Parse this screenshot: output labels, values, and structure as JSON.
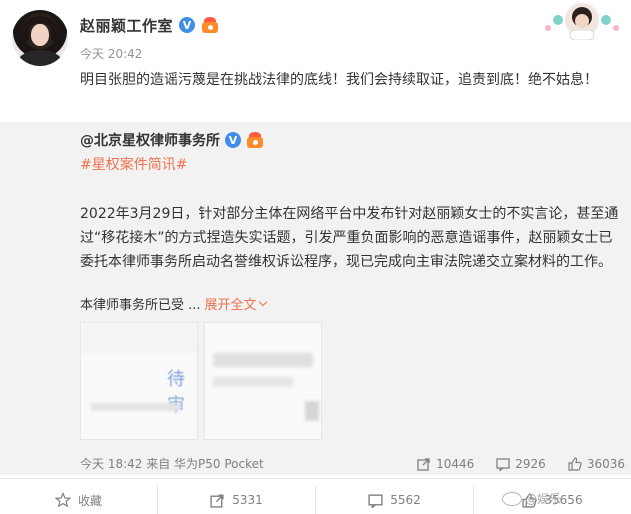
{
  "post": {
    "username": "赵丽颖工作室",
    "time": "今天 20:42",
    "text": "明目张胆的造谣污蔑是在挑战法律的底线！我们会持续取证，追责到底！绝不姑息！"
  },
  "repost": {
    "author": "@北京星权律师事务所",
    "tag": "#星权案件简讯#",
    "body": "2022年3月29日，针对部分主体在网络平台中发布针对赵丽颖女士的不实言论，甚至通过“移花接木”的方式捏造失实话题，引发严重负面影响的恶意造谣事件，赵丽颖女士已委托本律师事务所启动名誉维权诉讼程序，现已完成向主审法院递交立案材料的工作。",
    "summary": "本律师事务所已受 ...",
    "expand_label": "展开全文",
    "thumb_text": "待审",
    "meta": "今天 18:42 来自 华为P50 Pocket",
    "reposts": "10446",
    "comments": "2926",
    "likes": "36036"
  },
  "actions": {
    "favorite": "收藏",
    "repost": "5331",
    "comment": "5562",
    "like": "35656"
  },
  "watermark": "@娱乐"
}
